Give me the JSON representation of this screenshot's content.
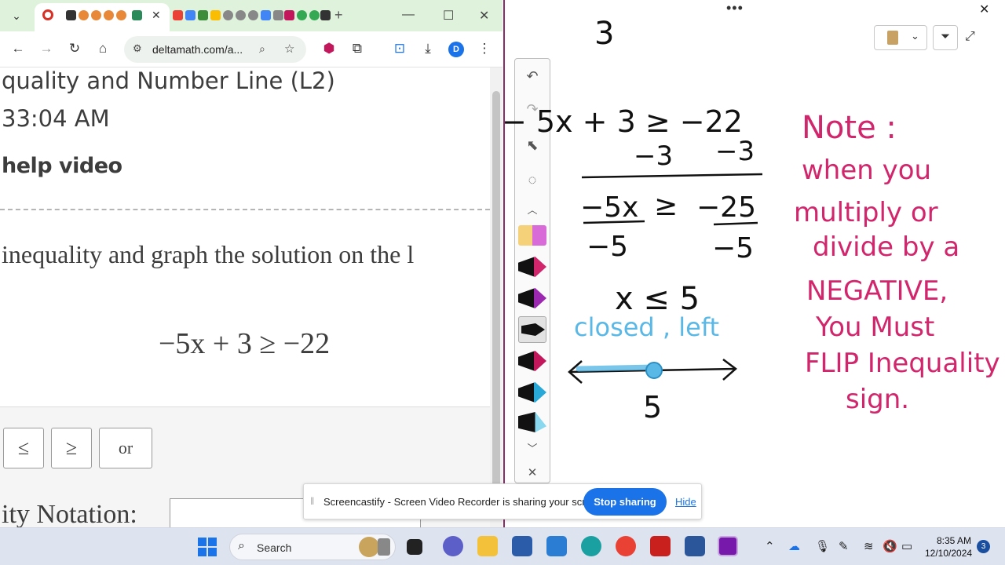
{
  "browser": {
    "url": "deltamath.com/a...",
    "profile_initial": "D"
  },
  "page": {
    "title": "quality and Number Line (L2)",
    "time": "33:04 AM",
    "help_video": "help video",
    "instruction": "inequality and graph the solution on the l",
    "problem": "−5x + 3 ≥ −22",
    "buttons": {
      "le": "≤",
      "ge": "≥",
      "or": "or"
    },
    "notation_label": "ity Notation:"
  },
  "whiteboard": {
    "top_number": "3",
    "step1": "− 5x + 3 ≥ −22",
    "step2_left": "−3",
    "step2_right": "−3",
    "step3_left": "−5x",
    "step3_sym": "≥",
    "step3_right": "−25",
    "den_left": "−5",
    "den_right": "−5",
    "result": "x ≤ 5",
    "closed_left": "closed , left",
    "number_line_label": "5",
    "note_title": "Note :",
    "note_lines": [
      "when you",
      "multiply or",
      "divide by a",
      "NEGATIVE,",
      "You Must",
      "FLIP Inequality",
      "sign."
    ]
  },
  "screencastify": {
    "message": "Screencastify - Screen Video Recorder is sharing your screen.",
    "stop_label": "Stop sharing",
    "hide_label": "Hide"
  },
  "taskbar": {
    "search_label": "Search",
    "time": "8:35 AM",
    "date": "12/10/2024",
    "notifications": "3"
  },
  "colors": {
    "accent_blue": "#1a73e8",
    "ink_black": "#111111",
    "ink_pink": "#d1266b",
    "ink_blue": "#5ab8e6",
    "tab_green": "#dff3dc"
  }
}
